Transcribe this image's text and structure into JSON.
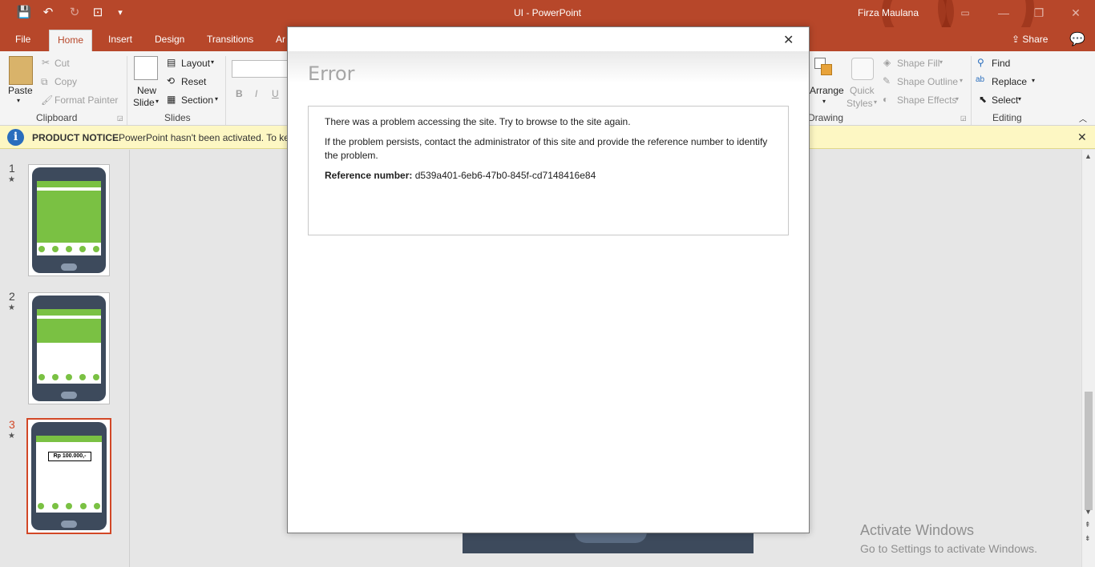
{
  "window": {
    "title": "UI  -  PowerPoint",
    "user": "Firza Maulana",
    "minimize": "—",
    "restore": "❐",
    "close": "✕"
  },
  "qat": {
    "save": "💾",
    "undo": "↶",
    "redo": "↻",
    "present": "⊡",
    "more": "▾"
  },
  "tabs": {
    "file": "File",
    "home": "Home",
    "insert": "Insert",
    "design": "Design",
    "transitions": "Transitions",
    "animations": "Ar",
    "share": "Share",
    "comment": "💬"
  },
  "ribbon": {
    "paste": "Paste",
    "cut": "Cut",
    "copy": "Copy",
    "format_painter": "Format Painter",
    "clipboard": "Clipboard",
    "new_slide_1": "New",
    "new_slide_2": "Slide",
    "layout": "Layout",
    "reset": "Reset",
    "section": "Section",
    "slides": "Slides",
    "bold": "B",
    "italic": "I",
    "underline": "U",
    "arrange": "Arrange",
    "quick_styles_1": "Quick",
    "quick_styles_2": "Styles",
    "shape_fill": "Shape Fill",
    "shape_outline": "Shape Outline",
    "shape_effects": "Shape Effects",
    "drawing": "Drawing",
    "find": "Find",
    "replace": "Replace",
    "select": "Select",
    "editing": "Editing"
  },
  "notice": {
    "label": "PRODUCT NOTICE",
    "text": "PowerPoint hasn't been activated. To ke",
    "close": "✕"
  },
  "slides": [
    {
      "number": "1",
      "star": "★"
    },
    {
      "number": "2",
      "star": "★"
    },
    {
      "number": "3",
      "star": "★",
      "amount": "Rp 100.000,-"
    }
  ],
  "dialog": {
    "close": "✕",
    "title": "Error",
    "line1": "There was a problem accessing the site. Try to browse to the site again.",
    "line2": "If the problem persists, contact the administrator of this site and provide the reference number to identify the problem.",
    "ref_label": "Reference number:",
    "ref_value": "d539a401-6eb6-47b0-845f-cd7148416e84"
  },
  "watermark": {
    "line1": "Activate Windows",
    "line2": "Go to Settings to activate Windows."
  },
  "colors": {
    "brand": "#b7472a",
    "notice": "#fdf7c3",
    "phone": "#3d4a5c",
    "screen_green": "#7ac143",
    "selected": "#d24726"
  }
}
